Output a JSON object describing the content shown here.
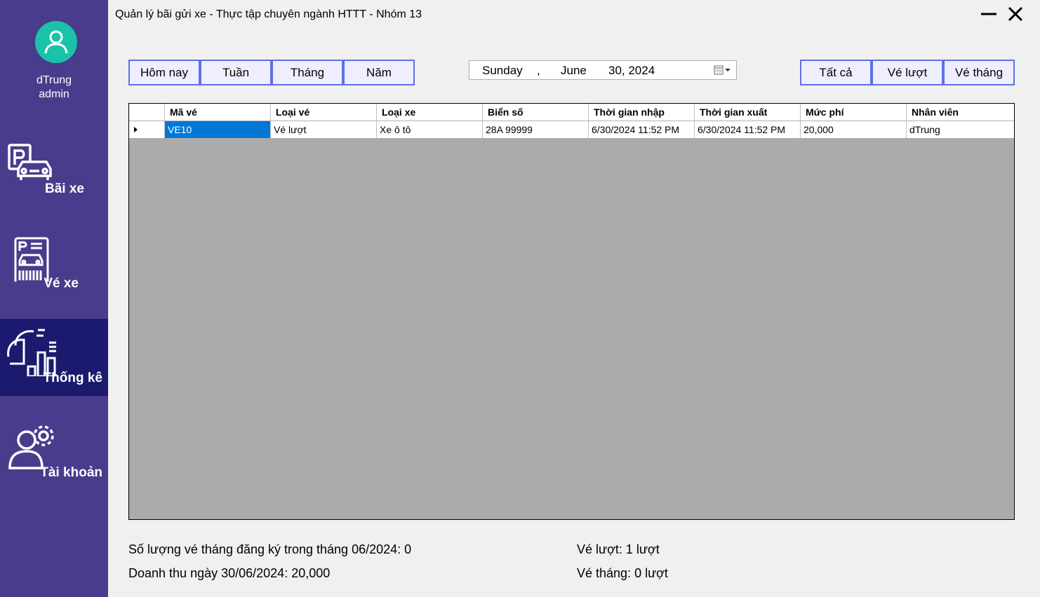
{
  "window": {
    "title": "Quản lý bãi gửi xe - Thực tập chuyên ngành HTTT - Nhóm 13"
  },
  "user": {
    "name": "dTrung",
    "role": "admin"
  },
  "sidebar": {
    "items": [
      {
        "label": "Bãi xe",
        "icon": "parking-car-icon"
      },
      {
        "label": "Vé xe",
        "icon": "parking-ticket-icon"
      },
      {
        "label": "Thống kê",
        "icon": "statistics-icon",
        "active": true
      },
      {
        "label": "Tài khoản",
        "icon": "user-settings-icon"
      }
    ]
  },
  "filters": {
    "period": [
      "Hôm nay",
      "Tuần",
      "Tháng",
      "Năm"
    ],
    "ticket_type": [
      "Tất cả",
      "Vé lượt",
      "Vé tháng"
    ]
  },
  "datepicker": {
    "day": "Sunday",
    "comma": ",",
    "month": "June",
    "date": "30, 2024"
  },
  "table": {
    "columns": [
      "Mã vé",
      "Loại vé",
      "Loại xe",
      "Biển số",
      "Thời gian nhập",
      "Thời gian xuất",
      "Mức phí",
      "Nhân viên"
    ],
    "rows": [
      [
        "VE10",
        "Vé lượt",
        "Xe ô tô",
        "28A 99999",
        "6/30/2024 11:52 PM",
        "6/30/2024 11:52 PM",
        "20,000",
        "dTrung"
      ]
    ]
  },
  "stats": {
    "monthly_registrations": "Số lượng vé tháng đăng ký trong tháng 06/2024: 0",
    "daily_revenue": "Doanh thu ngày 30/06/2024: 20,000",
    "single_tickets": "Vé lượt: 1 lượt",
    "monthly_tickets": "Vé tháng: 0 lượt"
  },
  "colors": {
    "sidebar": "#4a3c8c",
    "sidebar_active": "#1c1a6e",
    "accent": "#5b72e8",
    "selection": "#0078d7",
    "avatar": "#19c3a8"
  }
}
